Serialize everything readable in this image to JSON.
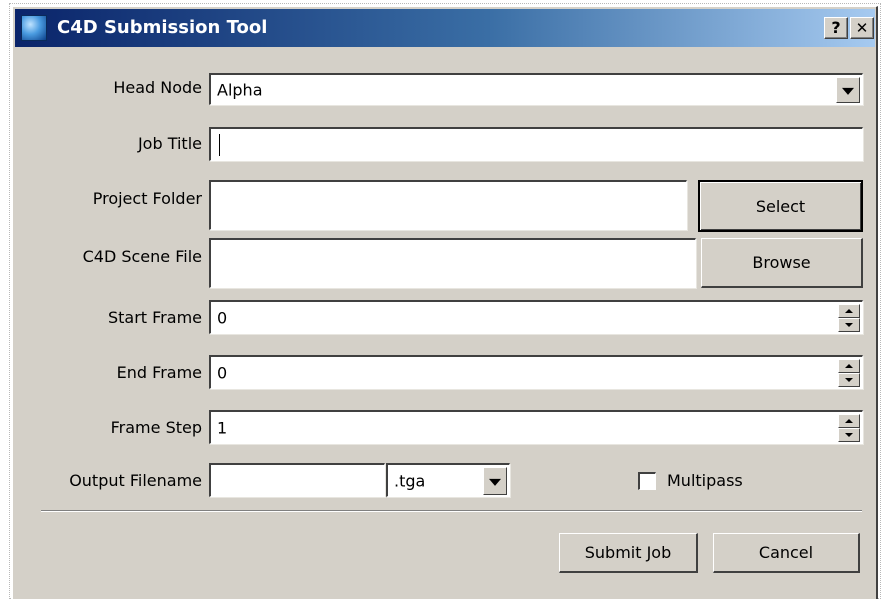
{
  "window": {
    "title": "C4D Submission Tool",
    "help_label": "?",
    "close_label": "✕"
  },
  "form": {
    "head_node": {
      "label": "Head Node",
      "value": "Alpha"
    },
    "job_title": {
      "label": "Job Title",
      "value": ""
    },
    "project_folder": {
      "label": "Project Folder",
      "value": "",
      "button": "Select"
    },
    "scene_file": {
      "label": "C4D Scene File",
      "value": "",
      "button": "Browse"
    },
    "start_frame": {
      "label": "Start Frame",
      "value": "0"
    },
    "end_frame": {
      "label": "End Frame",
      "value": "0"
    },
    "frame_step": {
      "label": "Frame Step",
      "value": "1"
    },
    "output_filename": {
      "label": "Output Filename",
      "value": "",
      "extension": ".tga"
    },
    "multipass": {
      "label": "Multipass",
      "checked": false
    }
  },
  "actions": {
    "submit": "Submit Job",
    "cancel": "Cancel"
  },
  "colors": {
    "face": "#d4d0c8",
    "title_start": "#0a246a",
    "title_end": "#a6caf0"
  }
}
